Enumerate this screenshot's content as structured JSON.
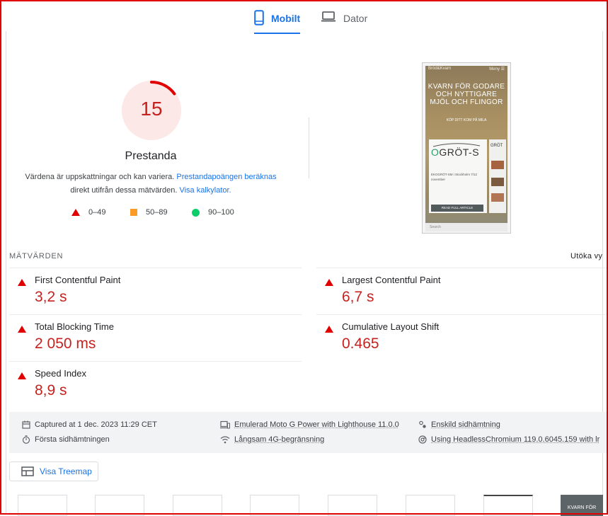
{
  "tabs": {
    "mobile": "Mobilt",
    "desktop": "Dator"
  },
  "score": {
    "value": "15",
    "fraction": 0.15,
    "title": "Prestanda",
    "desc_line1": "Värdena är uppskattningar och kan variera.",
    "desc_link1": "Prestandapoängen beräknas",
    "desc_line2": "direkt utifrån dessa mätvärden.",
    "desc_link2": "Visa kalkylator."
  },
  "legend": {
    "fail": "0–49",
    "average": "50–89",
    "pass": "90–100"
  },
  "colors": {
    "fail": "#e00000",
    "average": "#fa9b26",
    "pass": "#0cce6b",
    "accent": "#1a73e8"
  },
  "phone": {
    "site_name": "Bröd&Kvarn",
    "menu": "Meny",
    "headline": "KVARN FÖR GODARE OCH NYTTIGARE MJÖL OCH FLINGOR",
    "cta": "KÖP DITT KOM PÅ MILA",
    "card_logo_o": "O",
    "card_logo_rest": "GRÖT-S",
    "card_text": "EKOGRÖT-SM i Stockholm 7/12 november",
    "card_button": "READ FULL ARTICLE",
    "side_title": "GRÖT",
    "bottom_search": "Search"
  },
  "metrics": {
    "header": "MÄTVÄRDEN",
    "expand": "Utöka vy",
    "fcp": {
      "label": "First Contentful Paint",
      "value": "3,2 s"
    },
    "lcp": {
      "label": "Largest Contentful Paint",
      "value": "6,7 s"
    },
    "tbt": {
      "label": "Total Blocking Time",
      "value": "2 050 ms"
    },
    "cls": {
      "label": "Cumulative Layout Shift",
      "value": "0.465"
    },
    "si": {
      "label": "Speed Index",
      "value": "8,9 s"
    }
  },
  "info": {
    "captured": "Captured at 1 dec. 2023 11:29 CET",
    "first_load": "Första sidhämtningen",
    "emulated": "Emulerad Moto G Power with Lighthouse 11.0.0",
    "throttling": "Långsam 4G-begränsning",
    "single_load": "Enskild sidhämtning",
    "browser": "Using HeadlessChromium 119.0.6045.159 with lr"
  },
  "treemap": {
    "label": "Visa Treemap"
  },
  "filmstrip": {
    "last_frame_text": "KVARN FÖR"
  }
}
